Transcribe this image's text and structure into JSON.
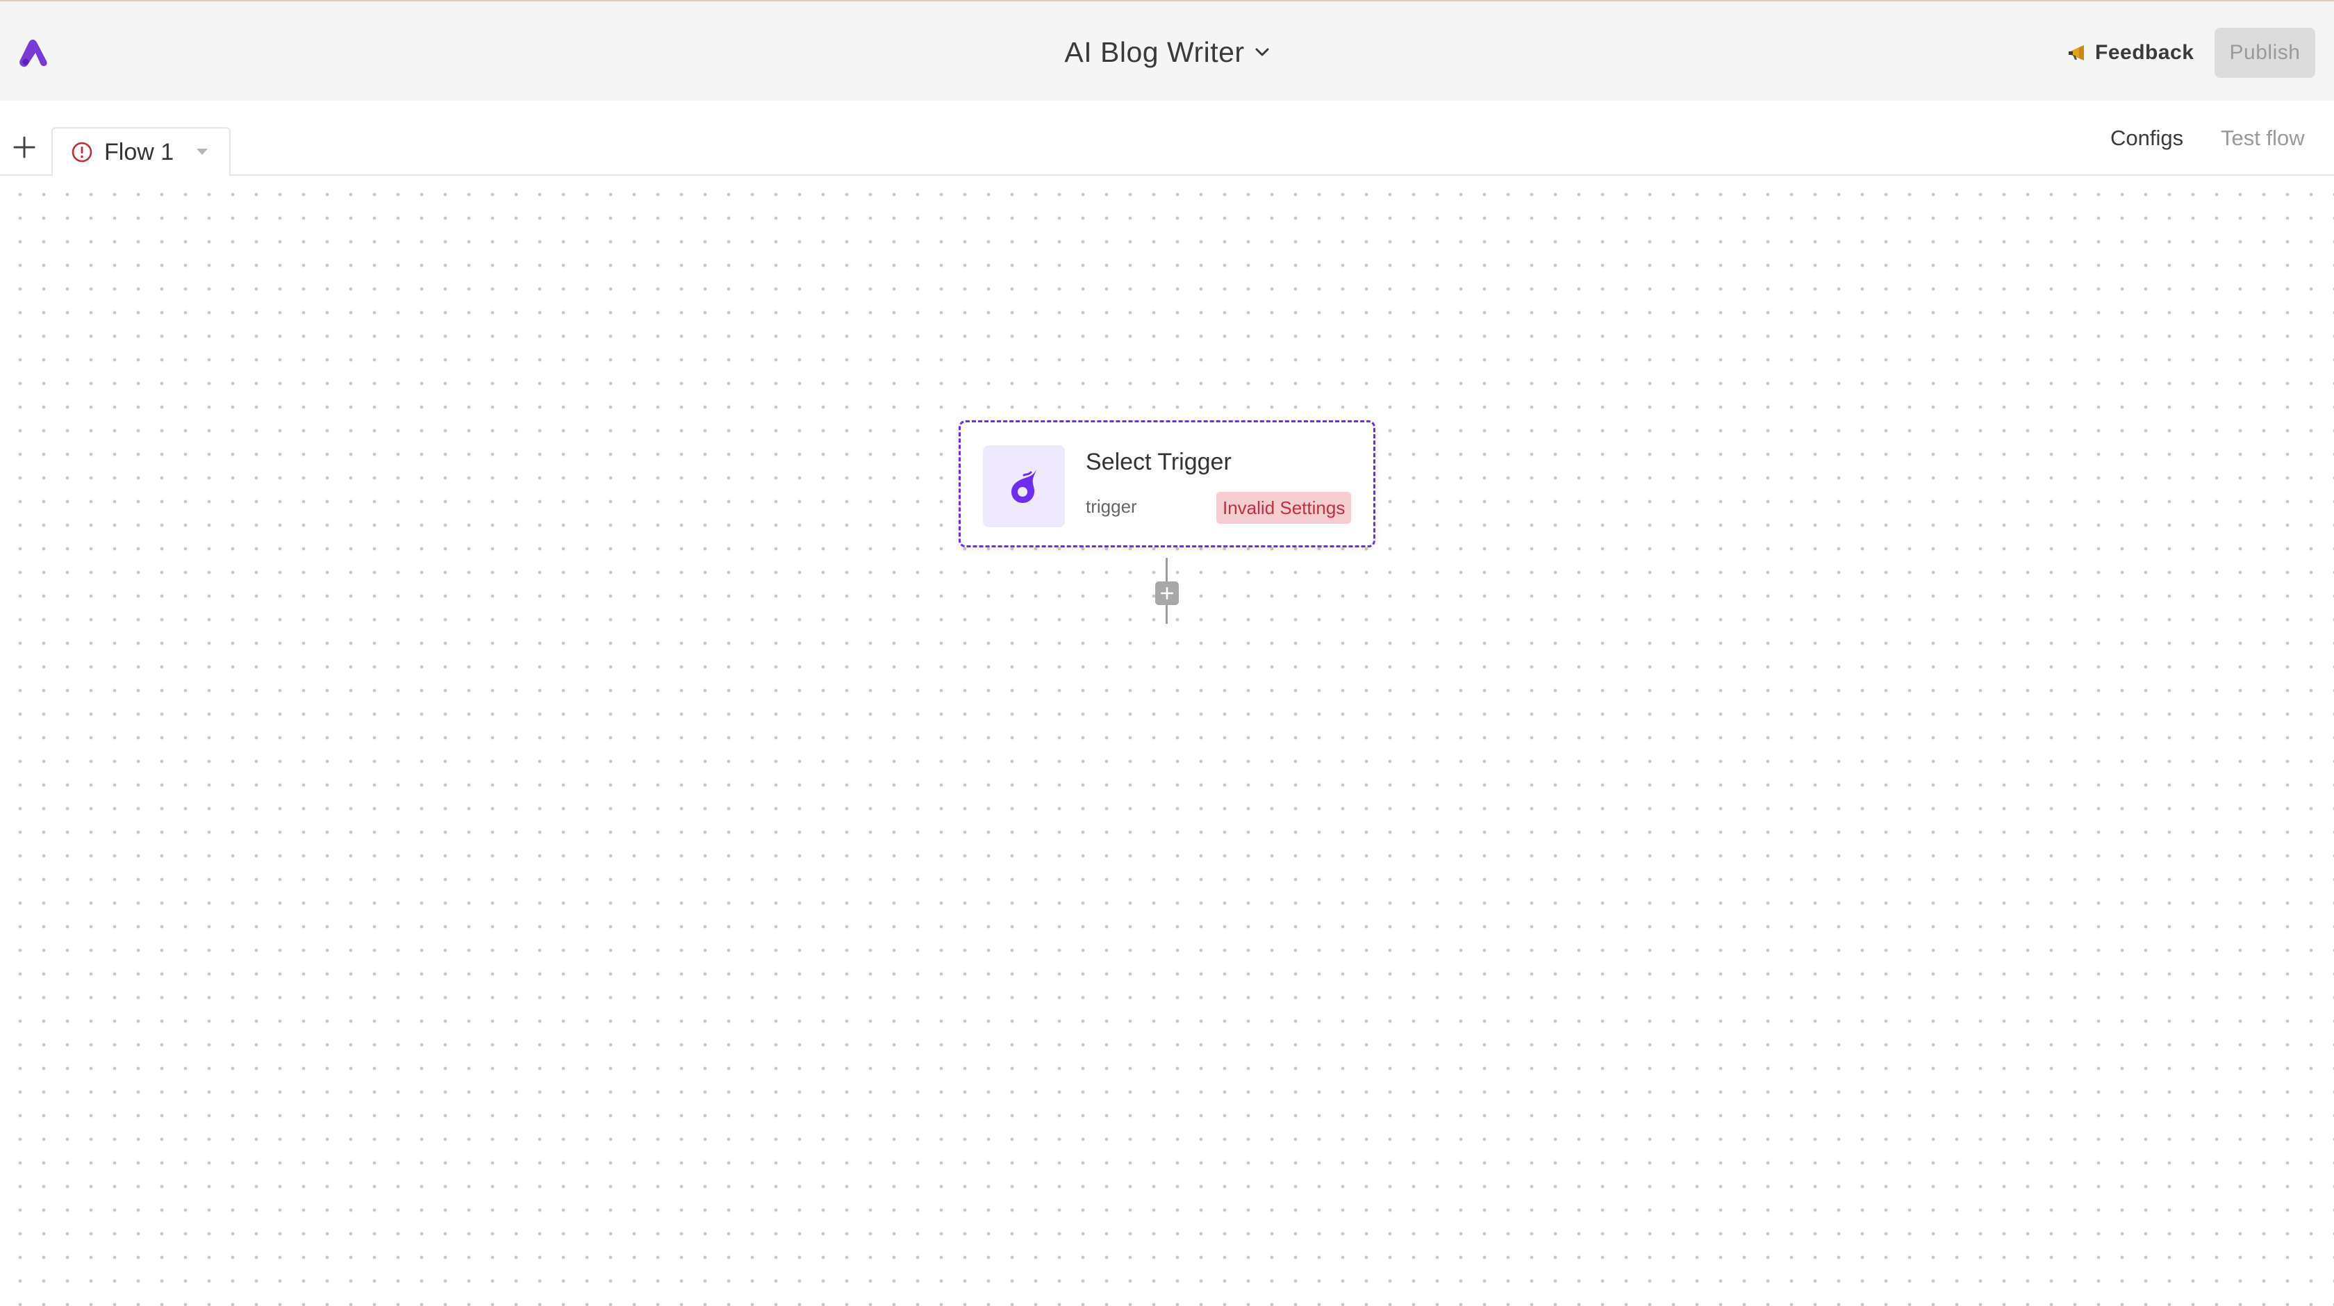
{
  "app": {
    "brand_color": "#7a3bd4",
    "flow_title": "AI Blog Writer"
  },
  "header": {
    "feedback_label": "Feedback",
    "publish_label": "Publish"
  },
  "tabbar": {
    "tabs": [
      {
        "label": "Flow 1",
        "status": "warning"
      }
    ],
    "configs_label": "Configs",
    "test_flow_label": "Test flow"
  },
  "canvas": {
    "trigger_node": {
      "title": "Select Trigger",
      "subtitle": "trigger",
      "badge": "Invalid Settings",
      "icon": "trigger-icon",
      "accent_color": "#6e2bf2"
    }
  },
  "colors": {
    "error": "#c0303a",
    "error_bg": "#f6cdd1",
    "disabled_text": "#9a9a9a"
  }
}
